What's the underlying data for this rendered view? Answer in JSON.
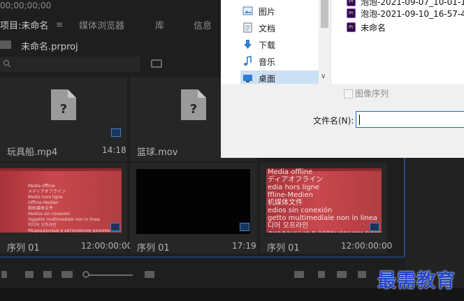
{
  "timecode": "00;00;00;00",
  "tabs": [
    {
      "label": "项目:未命名",
      "active": true
    },
    {
      "label": "媒体浏览器",
      "active": false
    },
    {
      "label": "库",
      "active": false
    },
    {
      "label": "信息",
      "active": false
    }
  ],
  "project_file": "未命名.prproj",
  "clips": [
    {
      "name": "玩具船.mp4",
      "duration": "14:18",
      "thumb": "file"
    },
    {
      "name": "篮球.mov",
      "duration": "",
      "thumb": "file"
    },
    {
      "name": "序列 01",
      "duration": "12:00:00:00",
      "thumb": "offline"
    },
    {
      "name": "序列 01",
      "duration": "17:19",
      "thumb": "black"
    },
    {
      "name": "序列 01",
      "duration": "12:00:00:00",
      "thumb": "offline"
    }
  ],
  "offline_text_small": "Media offline\nメディアオフライン\nMedia hors ligne\nOffline-Medien\n脱机媒体文件\nMedios sin conexión\nOggetto multimediale non in linea\n미디어 오프라인\nМедиаданные в автономном режиме\nMídia offline",
  "offline_text_large": "Media offline\nディアオフライン\nedia hors ligne\nffline-Medien\n机媒体文件\nedios sin conexión\ngetto multimediale non in linea\n디어 오프라인\nдиаданные в автономном режиме",
  "dialog": {
    "nav_items": [
      {
        "label": "图片",
        "icon": "pictures-icon"
      },
      {
        "label": "文档",
        "icon": "documents-icon"
      },
      {
        "label": "下载",
        "icon": "downloads-icon"
      },
      {
        "label": "音乐",
        "icon": "music-icon"
      },
      {
        "label": "桌面",
        "icon": "desktop-icon",
        "selected": true
      }
    ],
    "files": [
      {
        "label": "泡泡-2021-09-07_10-01-12"
      },
      {
        "label": "泡泡-2021-09-10_16-57-45"
      },
      {
        "label": "未命名"
      }
    ],
    "image_sequence_label": "图像序列",
    "filename_label": "文件名(N):",
    "filename_value": ""
  },
  "colors": {
    "accent_blue": "#3e7fd6",
    "premiere_purple": "#a14ce3",
    "watermark": "#2546c9"
  },
  "watermark": "最需教育"
}
